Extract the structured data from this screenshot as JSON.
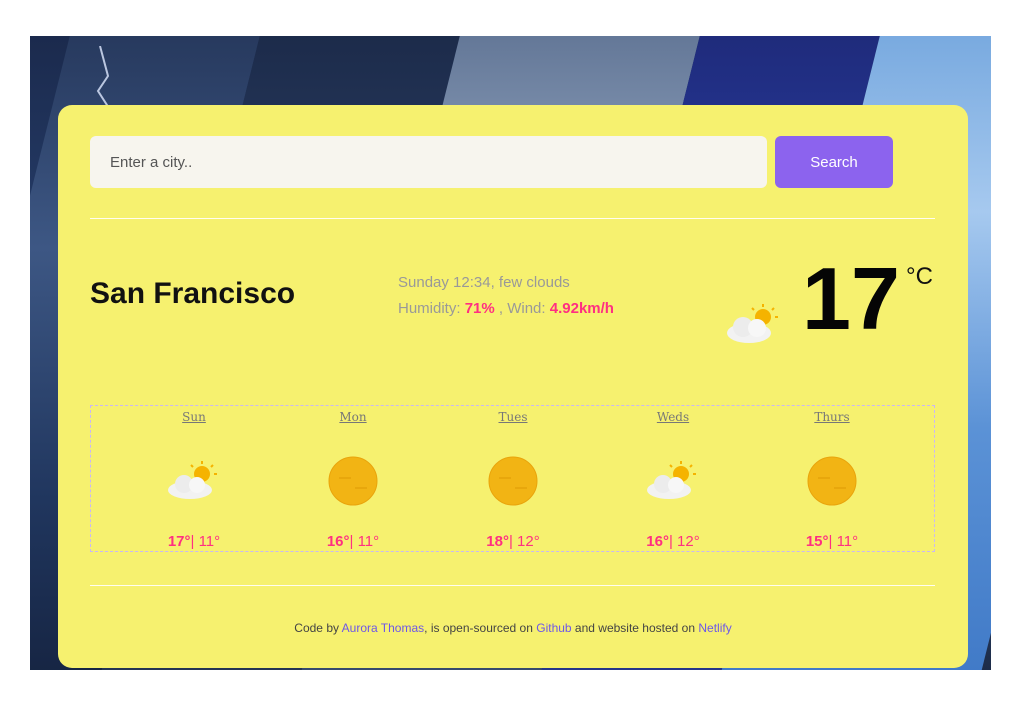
{
  "search": {
    "placeholder": "Enter a city..",
    "button_label": "Search"
  },
  "current": {
    "city": "San Francisco",
    "datetime_desc": "Sunday 12:34, few clouds",
    "humidity_label": "Humidity:",
    "humidity_value": "71%",
    "wind_label": ", Wind:",
    "wind_value": "4.92km/h",
    "temperature": "17",
    "unit": "°C",
    "icon": "few-clouds-icon"
  },
  "forecast": [
    {
      "day": "Sun",
      "high": "17°",
      "low": "| 11°",
      "icon": "few-clouds-icon"
    },
    {
      "day": "Mon",
      "high": "16°",
      "low": "| 11°",
      "icon": "sun-icon"
    },
    {
      "day": "Tues",
      "high": "18°",
      "low": "| 12°",
      "icon": "sun-icon"
    },
    {
      "day": "Weds",
      "high": "16°",
      "low": "| 12°",
      "icon": "few-clouds-icon"
    },
    {
      "day": "Thurs",
      "high": "15°",
      "low": "| 11°",
      "icon": "sun-icon"
    }
  ],
  "footer": {
    "prefix": "Code by ",
    "author": "Aurora Thomas",
    "middle": ", is open-sourced on ",
    "github": "Github",
    "middle2": " and website hosted on ",
    "netlify": "Netlify"
  },
  "colors": {
    "card": "#f6f16f",
    "accent": "#8c63ee",
    "highlight": "#ff2f82",
    "link": "#6d57e8"
  }
}
